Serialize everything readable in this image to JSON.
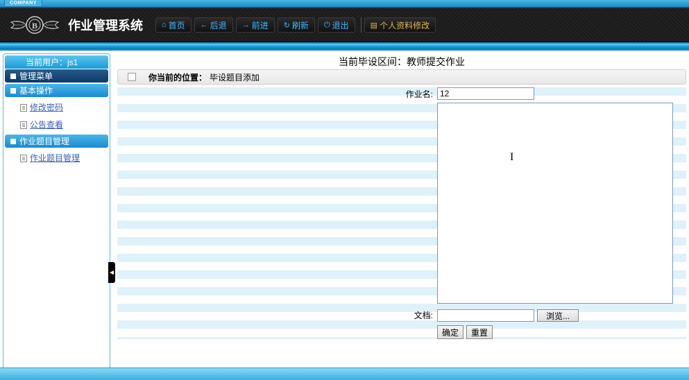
{
  "company_label": "COMPANY",
  "app_title": "作业管理系统",
  "nav": {
    "home": "首页",
    "back": "后退",
    "forward": "前进",
    "refresh": "刷新",
    "exit": "退出",
    "profile": "个人资料修改"
  },
  "sidebar": {
    "current_user_prefix": "当前用户：",
    "current_user": "js1",
    "menu_title": "管理菜单",
    "sections": [
      {
        "title": "基本操作",
        "items": [
          "修改密码",
          "公告查看"
        ]
      },
      {
        "title": "作业题目管理",
        "items": [
          "作业题目管理"
        ]
      }
    ]
  },
  "content": {
    "status_header": "当前毕设区间：教师提交作业",
    "location_label": "你当前的位置：",
    "location_value": "毕设题目添加",
    "form": {
      "name_label": "作业名:",
      "name_value": "12",
      "textarea_value": "",
      "doc_label": "文档:",
      "browse_label": "浏览...",
      "submit_label": "确定",
      "reset_label": "重置"
    }
  }
}
